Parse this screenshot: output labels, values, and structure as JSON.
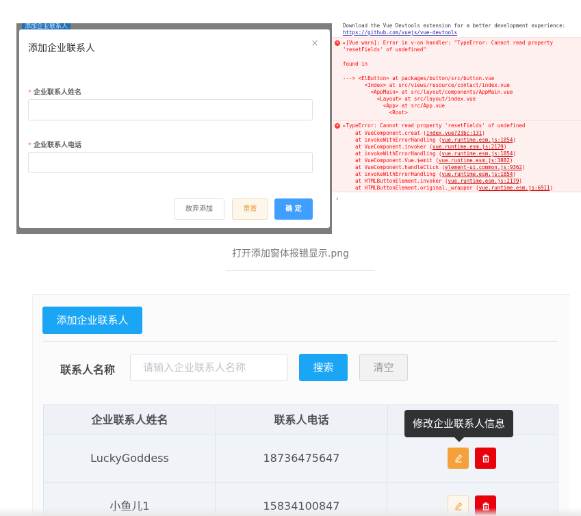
{
  "screenshot1": {
    "behind_tag": "添加企业联系人",
    "dialog": {
      "title": "添加企业联系人",
      "close_glyph": "×",
      "name_label": "企业联系人姓名",
      "phone_label": "企业联系人电话",
      "required_mark": "*",
      "name_value": "",
      "phone_value": "",
      "abandon_button": "放弃添加",
      "reset_button": "重置",
      "confirm_button": "确 定"
    },
    "console": {
      "intro_line1": "Download the Vue Devtools extension for a better development experience:",
      "intro_link": "https://github.com/vuejs/vue-devtools",
      "warn_line1": "▸[Vue warn]: Error in v-on handler: \"TypeError: Cannot read property",
      "warn_line2": "'resetFields' of undefined\"",
      "found_in": "found in",
      "trace1": "---> <ElButton> at packages/button/src/button.vue",
      "trace2": "       <Index> at src/views/resource/contact/index.vue",
      "trace3": "         <AppMain> at src/layout/components/AppMain.vue",
      "trace4": "           <Layout> at src/layout/index.vue",
      "trace5": "             <App> at src/App.vue",
      "trace6": "               <Root>",
      "type_error": "▸TypeError: Cannot read property 'resetFields' of undefined",
      "stack": [
        {
          "text": "    at VueComponent.creat (",
          "link": "index.vue?23bc:131",
          "end": ")"
        },
        {
          "text": "    at invokeWithErrorHandling (",
          "link": "vue.runtime.esm.js:1854",
          "end": ")"
        },
        {
          "text": "    at VueComponent.invoker (",
          "link": "vue.runtime.esm.js:2179",
          "end": ")"
        },
        {
          "text": "    at invokeWithErrorHandling (",
          "link": "vue.runtime.esm.js:1854",
          "end": ")"
        },
        {
          "text": "    at VueComponent.Vue.$emit (",
          "link": "vue.runtime.esm.js:3882",
          "end": ")"
        },
        {
          "text": "    at VueComponent.handleClick (",
          "link": "element-ui.common.js:9362",
          "end": ")"
        },
        {
          "text": "    at invokeWithErrorHandling (",
          "link": "vue.runtime.esm.js:1854",
          "end": ")"
        },
        {
          "text": "    at HTMLButtonElement.invoker (",
          "link": "vue.runtime.esm.js:2179",
          "end": ")"
        },
        {
          "text": "    at HTMLButtonElement.original._wrapper (",
          "link": "vue.runtime.esm.js:6911",
          "end": ")"
        }
      ],
      "prompt": "›"
    }
  },
  "caption": "打开添加窗体报错显示.png",
  "screenshot2": {
    "add_button": "添加企业联系人",
    "search_label": "联系人名称",
    "search_placeholder": "请输入企业联系人名称",
    "search_button": "搜索",
    "clear_button": "清空",
    "columns": [
      "企业联系人姓名",
      "联系人电话",
      ""
    ],
    "rows": [
      {
        "name": "LuckyGoddess",
        "phone": "18736475647"
      },
      {
        "name": "小鱼儿1",
        "phone": "15834100847"
      }
    ],
    "tooltip": "修改企业联系人信息",
    "icons": {
      "edit": "pencil-icon",
      "delete": "trash-icon"
    },
    "colors": {
      "primary": "#1aa5f5",
      "warning": "#f4a13b",
      "danger": "#e8000b"
    }
  }
}
